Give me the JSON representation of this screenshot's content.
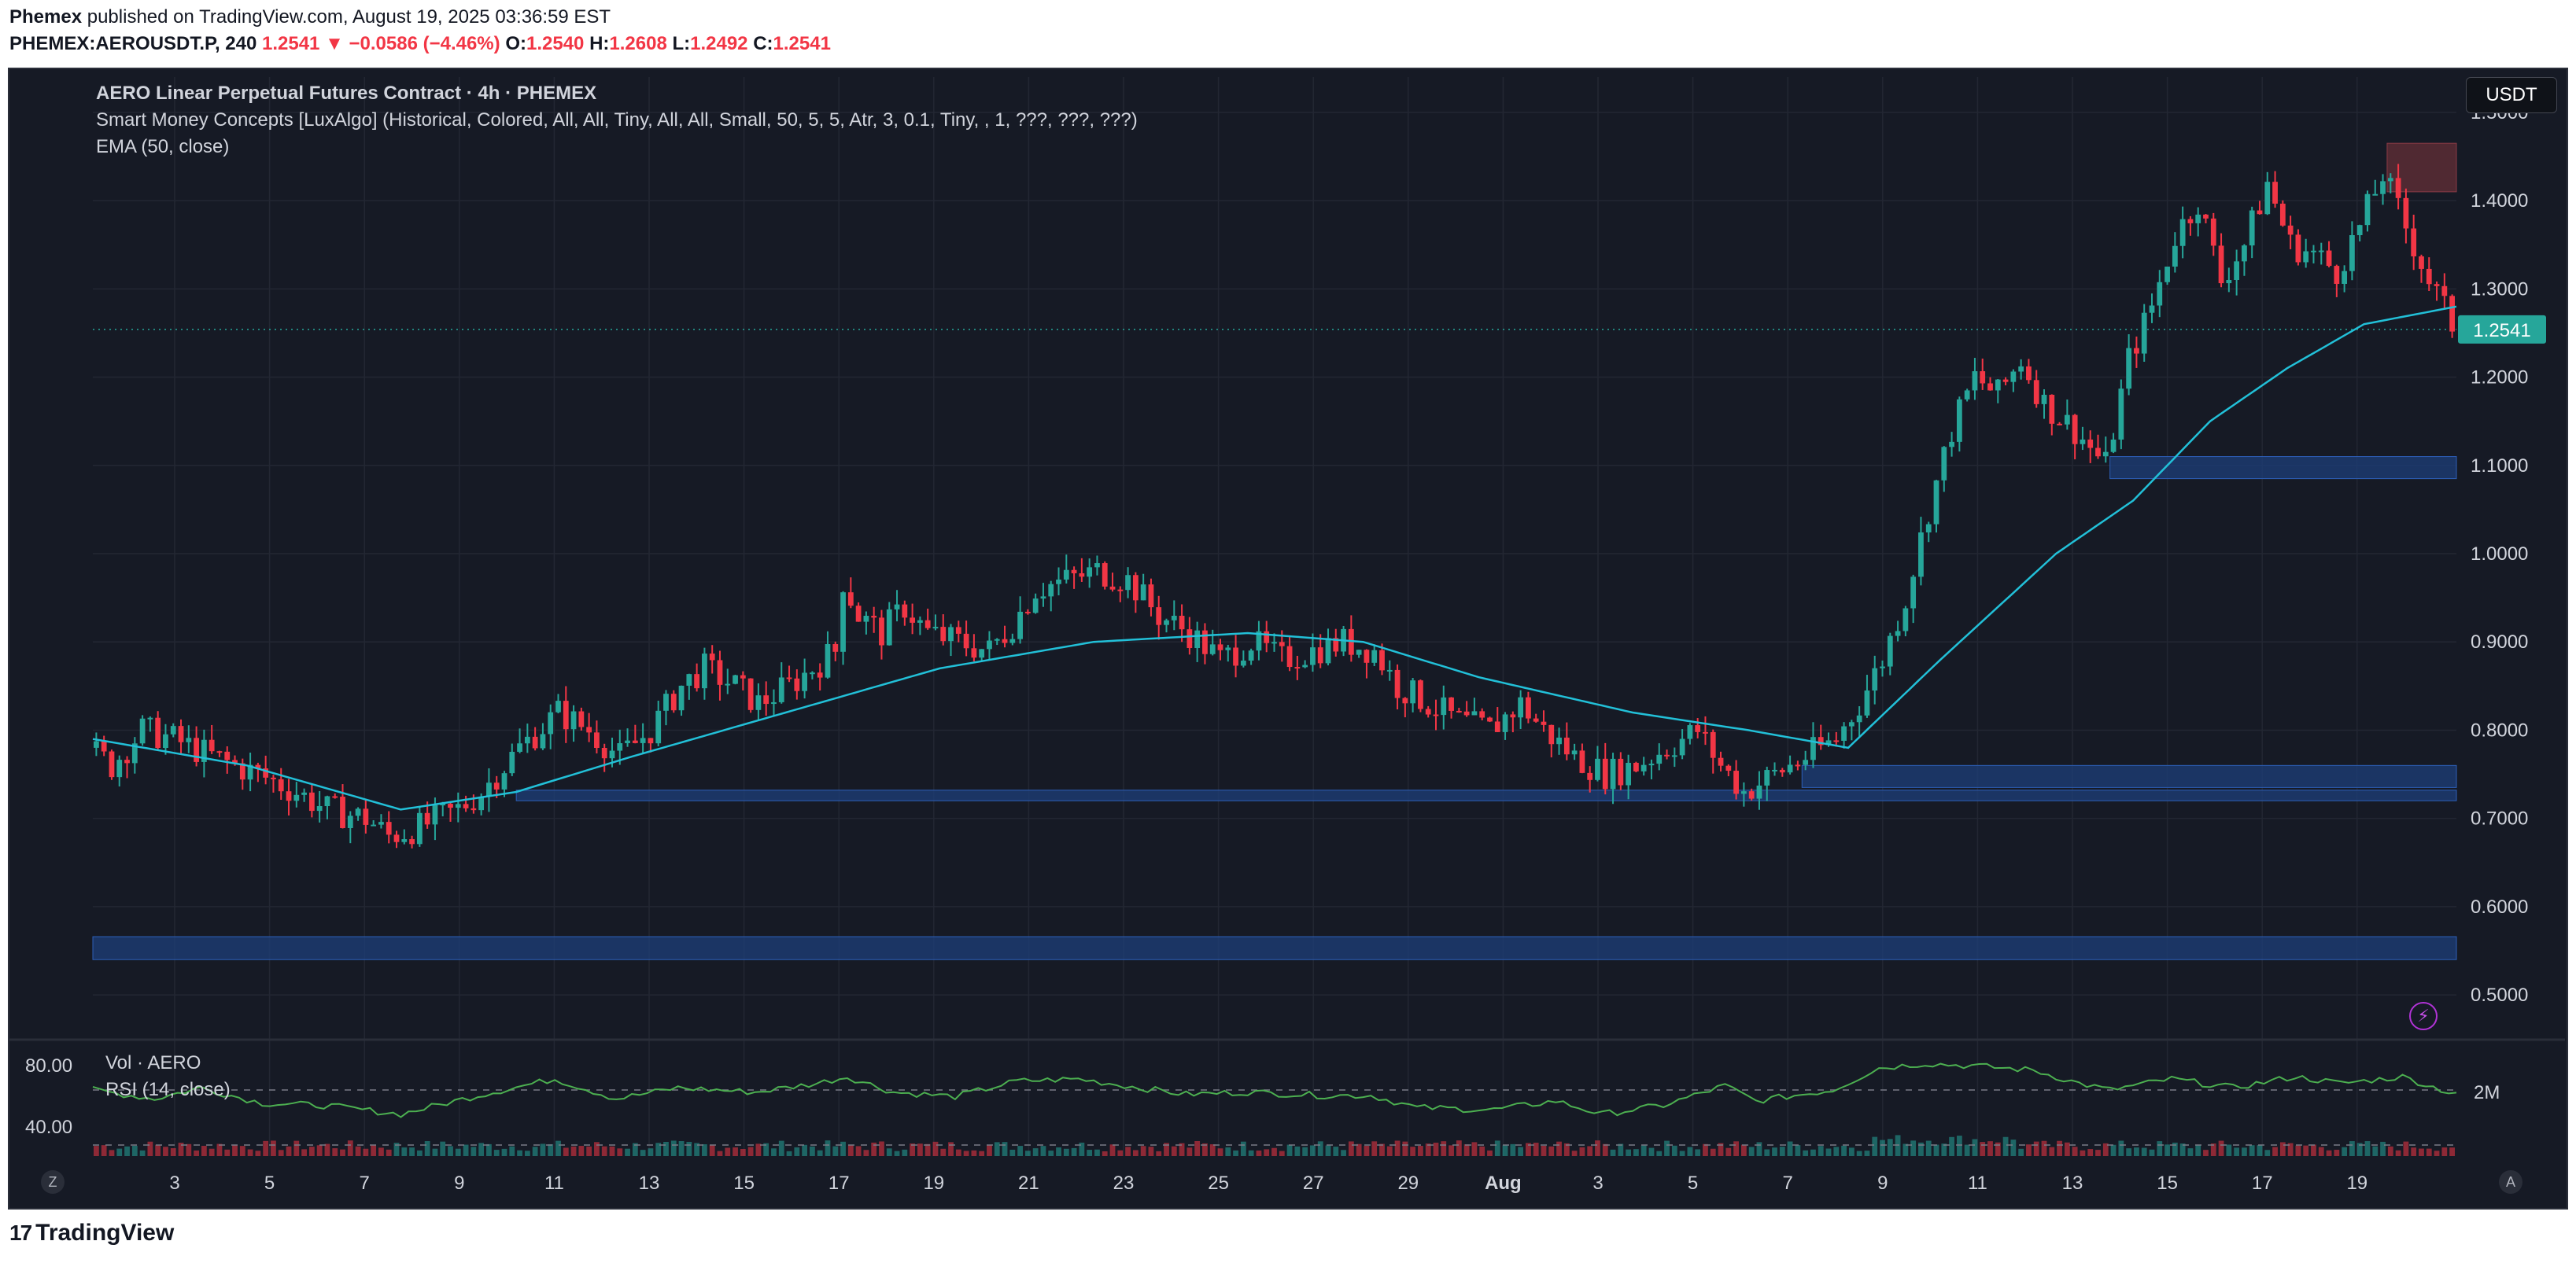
{
  "header": {
    "publisher": "Phemex",
    "published_text": "published on TradingView.com, August 19, 2025 03:36:59 EST",
    "symbol": "PHEMEX:AEROUSDT.P, 240",
    "last": "1.2541",
    "change": "▼ −0.0586 (−4.46%)",
    "o_label": "O:",
    "o_value": "1.2540",
    "h_label": "H:",
    "h_value": "1.2608",
    "l_label": "L:",
    "l_value": "1.2492",
    "c_label": "C:",
    "c_value": "1.2541"
  },
  "legend": {
    "title": "AERO Linear Perpetual Futures Contract · 4h · PHEMEX",
    "smc": "Smart Money Concepts [LuxAlgo] (Historical, Colored, All, All, Tiny, All, All, Small, 50, 5, 5, Atr, 3, 0.1, Tiny, , 1, ???, ???, ???)",
    "ema": "EMA (50, close)"
  },
  "currency_button": "USDT",
  "price_label": "1.2541",
  "price_axis": [
    "1.5000",
    "1.4000",
    "1.3000",
    "1.2000",
    "1.1000",
    "1.0000",
    "0.9000",
    "0.8000",
    "0.7000",
    "0.6000",
    "0.5000"
  ],
  "time_axis": [
    "3",
    "5",
    "7",
    "9",
    "11",
    "13",
    "15",
    "17",
    "19",
    "21",
    "23",
    "25",
    "27",
    "29",
    "Aug",
    "3",
    "5",
    "7",
    "9",
    "11",
    "13",
    "15",
    "17",
    "19"
  ],
  "lower_pane": {
    "vol_label": "Vol · AERO",
    "rsi_label": "RSI (14, close)",
    "rsi_80": "80.00",
    "rsi_40": "40.00",
    "vol_scale": "2M"
  },
  "buttons": {
    "z": "Z",
    "a": "A"
  },
  "footer": {
    "brand": "TradingView"
  },
  "colors": {
    "up": "#26a69a",
    "down": "#f23645",
    "ema": "#22c0d8",
    "rsi": "#4caf50",
    "demand_zone": "#1e3f7a",
    "supply_zone": "#5a2d35",
    "background": "#161a25"
  },
  "chart_data": {
    "type": "candlestick",
    "title": "AERO Linear Perpetual Futures Contract · 4h · PHEMEX",
    "interval": "4h",
    "ylim": [
      0.46,
      1.54
    ],
    "price_close_path": [
      [
        0,
        0.78
      ],
      [
        3,
        0.76
      ],
      [
        7,
        0.8
      ],
      [
        11,
        0.79
      ],
      [
        16,
        0.77
      ],
      [
        22,
        0.75
      ],
      [
        27,
        0.73
      ],
      [
        31,
        0.71
      ],
      [
        36,
        0.7
      ],
      [
        39,
        0.68
      ],
      [
        43,
        0.69
      ],
      [
        48,
        0.71
      ],
      [
        51,
        0.73
      ],
      [
        56,
        0.78
      ],
      [
        61,
        0.82
      ],
      [
        65,
        0.8
      ],
      [
        69,
        0.77
      ],
      [
        73,
        0.8
      ],
      [
        77,
        0.85
      ],
      [
        80,
        0.87
      ],
      [
        84,
        0.85
      ],
      [
        87,
        0.83
      ],
      [
        91,
        0.85
      ],
      [
        94,
        0.87
      ],
      [
        97,
        0.89
      ],
      [
        98,
        0.97
      ],
      [
        100,
        0.93
      ],
      [
        103,
        0.91
      ],
      [
        106,
        0.94
      ],
      [
        109,
        0.91
      ],
      [
        113,
        0.9
      ],
      [
        117,
        0.89
      ],
      [
        120,
        0.92
      ],
      [
        123,
        0.96
      ],
      [
        127,
        0.97
      ],
      [
        131,
        0.98
      ],
      [
        135,
        0.97
      ],
      [
        139,
        0.93
      ],
      [
        143,
        0.91
      ],
      [
        147,
        0.88
      ],
      [
        151,
        0.9
      ],
      [
        155,
        0.88
      ],
      [
        159,
        0.89
      ],
      [
        163,
        0.9
      ],
      [
        167,
        0.89
      ],
      [
        170,
        0.85
      ],
      [
        174,
        0.83
      ],
      [
        178,
        0.81
      ],
      [
        182,
        0.8
      ],
      [
        186,
        0.83
      ],
      [
        189,
        0.8
      ],
      [
        193,
        0.77
      ],
      [
        197,
        0.75
      ],
      [
        201,
        0.76
      ],
      [
        205,
        0.78
      ],
      [
        209,
        0.8
      ],
      [
        212,
        0.76
      ],
      [
        215,
        0.73
      ],
      [
        219,
        0.75
      ],
      [
        223,
        0.77
      ],
      [
        227,
        0.79
      ],
      [
        230,
        0.83
      ],
      [
        233,
        0.88
      ],
      [
        236,
        0.95
      ],
      [
        239,
        1.05
      ],
      [
        242,
        1.14
      ],
      [
        245,
        1.2
      ],
      [
        248,
        1.18
      ],
      [
        251,
        1.22
      ],
      [
        254,
        1.17
      ],
      [
        258,
        1.14
      ],
      [
        262,
        1.1
      ],
      [
        265,
        1.22
      ],
      [
        268,
        1.28
      ],
      [
        271,
        1.36
      ],
      [
        274,
        1.4
      ],
      [
        277,
        1.31
      ],
      [
        280,
        1.35
      ],
      [
        283,
        1.42
      ],
      [
        286,
        1.35
      ],
      [
        289,
        1.34
      ],
      [
        292,
        1.32
      ],
      [
        295,
        1.37
      ],
      [
        298,
        1.43
      ],
      [
        301,
        1.37
      ],
      [
        304,
        1.31
      ],
      [
        307,
        1.26
      ]
    ],
    "ema50_path": [
      [
        0,
        0.79
      ],
      [
        20,
        0.76
      ],
      [
        40,
        0.71
      ],
      [
        55,
        0.73
      ],
      [
        70,
        0.77
      ],
      [
        90,
        0.82
      ],
      [
        110,
        0.87
      ],
      [
        130,
        0.9
      ],
      [
        150,
        0.91
      ],
      [
        165,
        0.9
      ],
      [
        180,
        0.86
      ],
      [
        200,
        0.82
      ],
      [
        215,
        0.8
      ],
      [
        228,
        0.78
      ],
      [
        240,
        0.88
      ],
      [
        255,
        1.0
      ],
      [
        265,
        1.06
      ],
      [
        275,
        1.15
      ],
      [
        285,
        1.21
      ],
      [
        295,
        1.26
      ],
      [
        307,
        1.28
      ]
    ],
    "zones": [
      {
        "type": "demand",
        "x": [
          0,
          307
        ],
        "y": [
          0.54,
          0.566
        ]
      },
      {
        "type": "demand",
        "x": [
          55,
          307
        ],
        "y": [
          0.72,
          0.732
        ]
      },
      {
        "type": "demand",
        "x": [
          222,
          307
        ],
        "y": [
          0.735,
          0.76
        ]
      },
      {
        "type": "demand",
        "x": [
          262,
          307
        ],
        "y": [
          1.085,
          1.11
        ]
      },
      {
        "type": "supply",
        "x": [
          298,
          307
        ],
        "y": [
          1.41,
          1.465
        ]
      }
    ],
    "rsi_path": [
      [
        0,
        60
      ],
      [
        8,
        52
      ],
      [
        14,
        62
      ],
      [
        22,
        48
      ],
      [
        30,
        46
      ],
      [
        40,
        38
      ],
      [
        50,
        55
      ],
      [
        60,
        70
      ],
      [
        68,
        52
      ],
      [
        76,
        62
      ],
      [
        86,
        58
      ],
      [
        94,
        66
      ],
      [
        98,
        72
      ],
      [
        104,
        58
      ],
      [
        112,
        54
      ],
      [
        120,
        68
      ],
      [
        128,
        70
      ],
      [
        136,
        62
      ],
      [
        142,
        56
      ],
      [
        150,
        58
      ],
      [
        160,
        55
      ],
      [
        166,
        55
      ],
      [
        172,
        44
      ],
      [
        182,
        42
      ],
      [
        190,
        50
      ],
      [
        196,
        38
      ],
      [
        204,
        46
      ],
      [
        212,
        64
      ],
      [
        216,
        50
      ],
      [
        226,
        60
      ],
      [
        232,
        80
      ],
      [
        238,
        84
      ],
      [
        244,
        82
      ],
      [
        252,
        78
      ],
      [
        258,
        66
      ],
      [
        262,
        60
      ],
      [
        270,
        70
      ],
      [
        278,
        62
      ],
      [
        286,
        72
      ],
      [
        292,
        66
      ],
      [
        300,
        72
      ],
      [
        306,
        58
      ]
    ],
    "rsi_levels": [
      70,
      30
    ]
  }
}
